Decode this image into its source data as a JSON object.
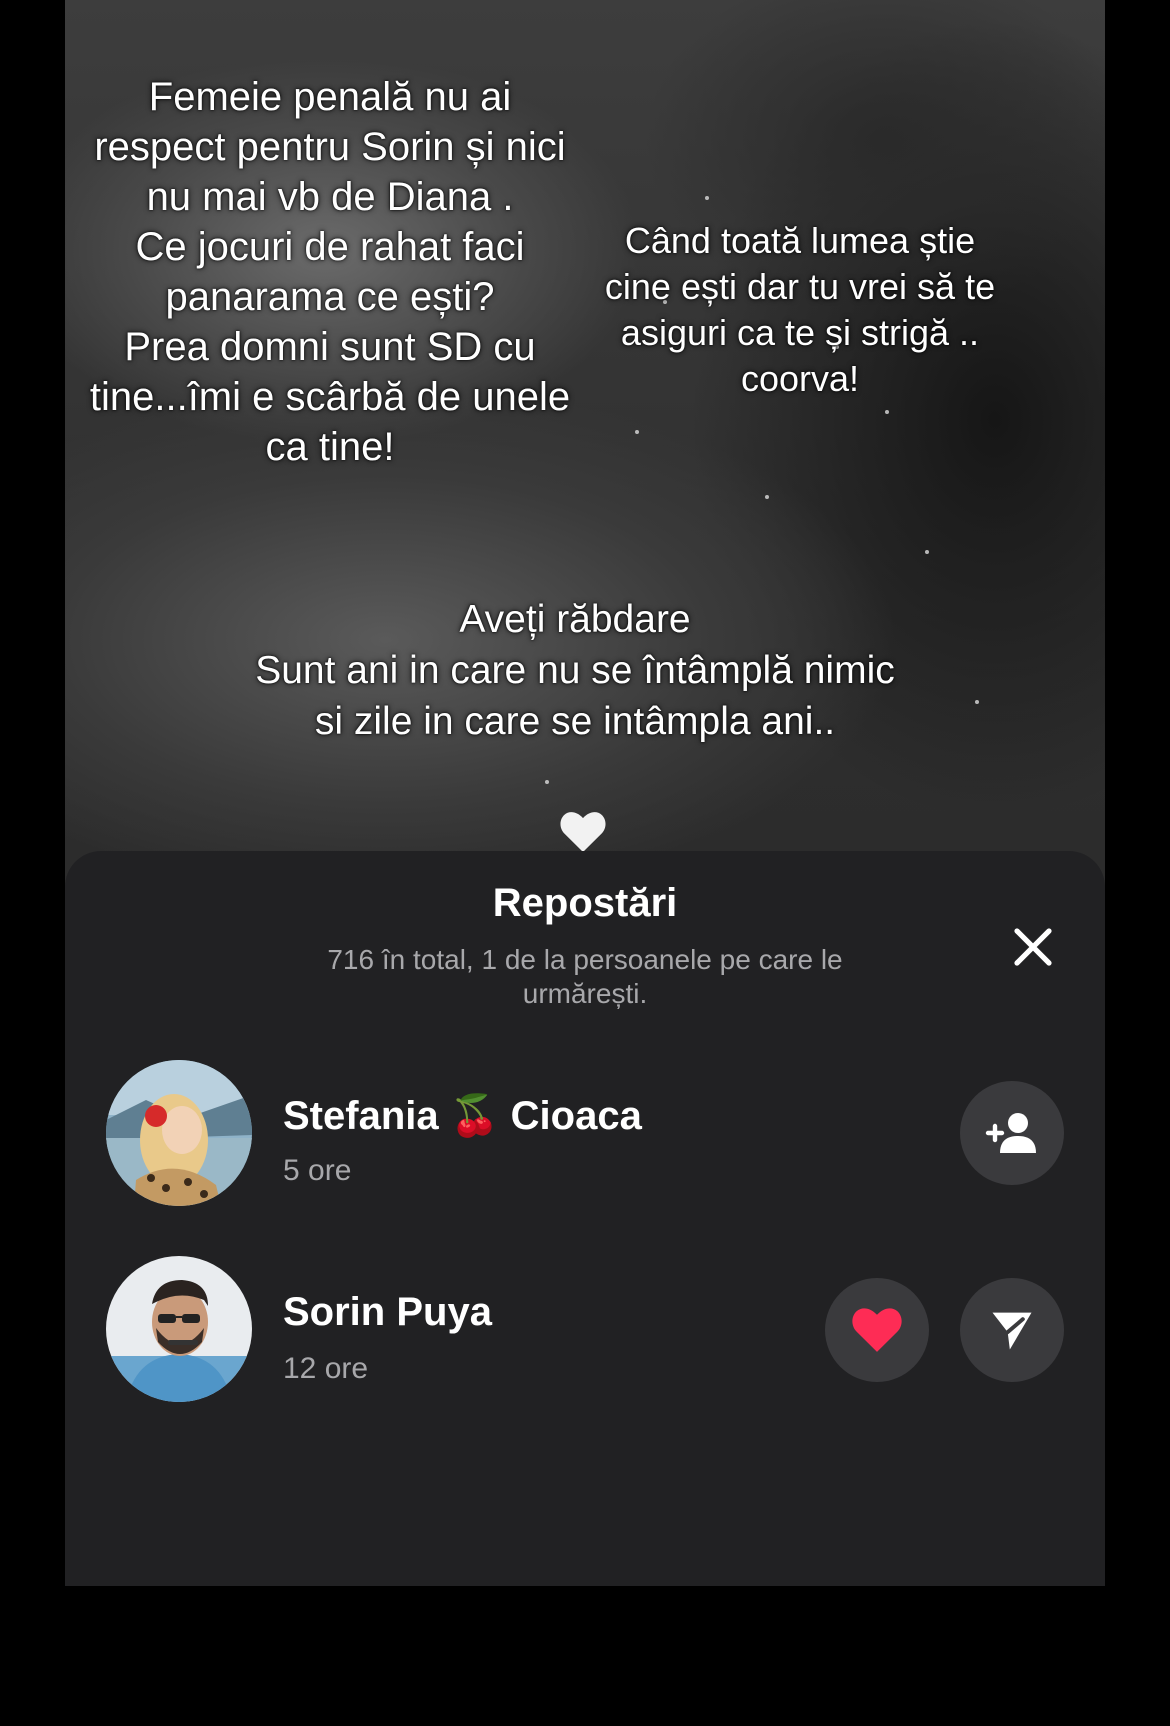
{
  "background_text": {
    "left_lines": [
      "Femeie penală nu ai",
      "respect pentru Sorin și nici",
      "nu mai vb de Diana .",
      "Ce jocuri de rahat faci",
      "panarama ce ești?",
      "Prea domni sunt SD cu",
      "tine...îmi e scârbă de unele",
      "ca tine!"
    ],
    "right_lines": [
      "Când toată lumea știe",
      "cine ești dar tu vrei să te",
      "asiguri ca te și strigă ..",
      "coorva!"
    ],
    "center_lines": [
      "Aveți răbdare",
      "Sunt ani in care nu se întâmplă nimic",
      "si zile in care se intâmpla ani.."
    ]
  },
  "sheet": {
    "title": "Repostări",
    "subtitle": "716 în total, 1 de la persoanele pe care le urmărești.",
    "close_icon": "close-icon",
    "users": [
      {
        "name_first": "Stefania",
        "name_emoji": "🍒",
        "name_last": "Cioaca",
        "time": "5 ore",
        "action_icon": "add-user-icon"
      },
      {
        "name": "Sorin Puya",
        "time": "12 ore",
        "action_icons": [
          "heart-icon",
          "send-icon"
        ]
      }
    ]
  },
  "colors": {
    "sheet_bg": "#212123",
    "button_bg": "#3a3a3d",
    "secondary_text": "#a8a8ab",
    "heart_red": "#fe2c55"
  }
}
